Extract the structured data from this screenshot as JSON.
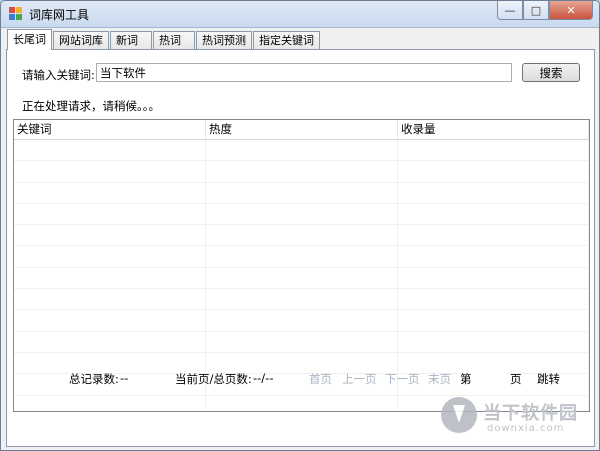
{
  "window": {
    "title": "词库网工具",
    "controls": [
      "minimize-icon",
      "maximize-icon",
      "close-icon"
    ]
  },
  "tabs": [
    {
      "label": "长尾词",
      "active": true
    },
    {
      "label": "网站词库",
      "active": false
    },
    {
      "label": "新词",
      "active": false
    },
    {
      "label": "热词",
      "active": false
    },
    {
      "label": "热词预测",
      "active": false
    },
    {
      "label": "指定关键词",
      "active": false
    }
  ],
  "search": {
    "label": "请输入关键词:",
    "value": "当下软件",
    "button_label": "搜索"
  },
  "status": "正在处理请求，请稍候。。。",
  "table": {
    "columns": [
      "关键词",
      "热度",
      "收录量"
    ],
    "rows": []
  },
  "footer": {
    "total_label": "总记录数:",
    "total_value": "--",
    "page_label": "当前页/总页数:",
    "page_value": "--/--",
    "first": "首页",
    "prev": "上一页",
    "next": "下一页",
    "last": "末页",
    "goto_prefix": "第",
    "goto_suffix": "页",
    "goto_button": "跳转"
  },
  "watermark": {
    "text": "当下软件园",
    "sub": "downxia.com"
  }
}
